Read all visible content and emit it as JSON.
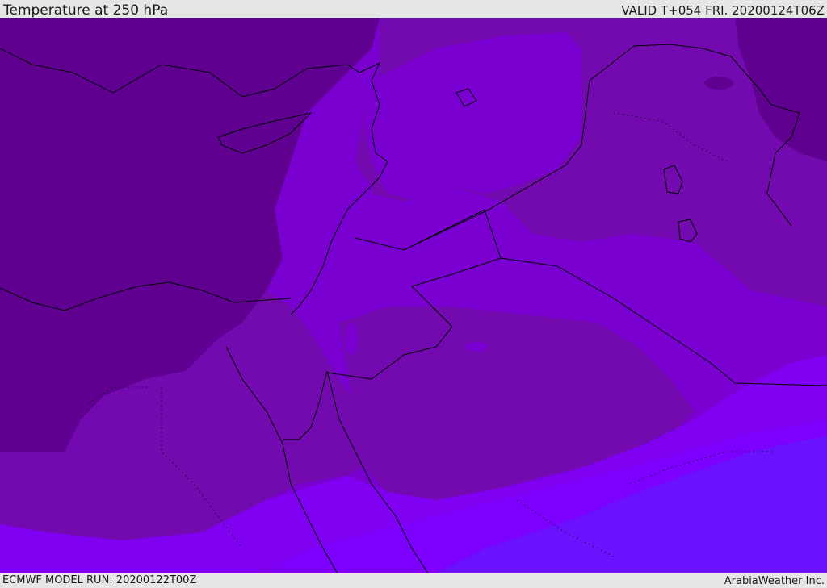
{
  "header": {
    "title": "Temperature at 250 hPa",
    "valid": "VALID T+054 FRI. 20200124T06Z"
  },
  "footer": {
    "model_run": "ECMWF MODEL RUN: 20200122T00Z",
    "credit": "ArabiaWeather Inc."
  },
  "colors": {
    "coldest": "#5f0090",
    "cold": "#730aaf",
    "mid": "#7a00d2",
    "warm": "#8000f2",
    "warmer": "#7d00ff",
    "warmest": "#6a12ff",
    "coastline": "#000000"
  }
}
